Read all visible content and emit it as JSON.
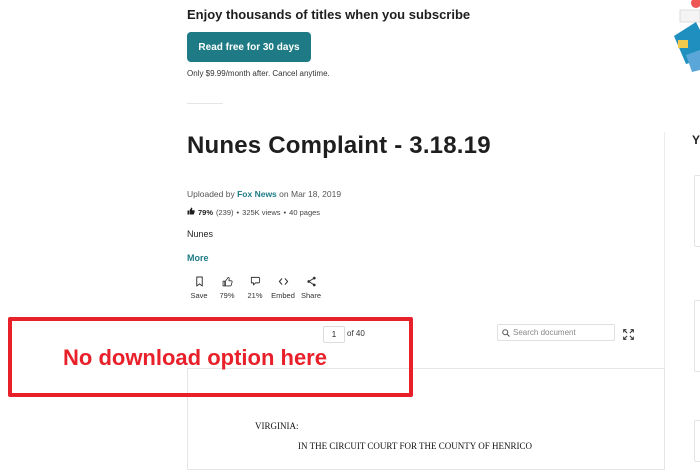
{
  "promo": {
    "title": "Enjoy thousands of titles when you subscribe",
    "cta_label": "Read free for 30 days",
    "note": "Only $9.99/month after. Cancel anytime."
  },
  "document": {
    "title": "Nunes Complaint - 3.18.19",
    "uploaded_prefix": "Uploaded by",
    "uploader": "Fox News",
    "uploaded_date": "on Mar 18, 2019",
    "rating_percent": "79%",
    "rating_count": "(239)",
    "views": "325K views",
    "pages": "40 pages",
    "description": "Nunes",
    "more_label": "More"
  },
  "actions": [
    {
      "label": "Save",
      "icon": "bookmark-icon"
    },
    {
      "label": "79%",
      "icon": "thumbs-up-icon"
    },
    {
      "label": "21%",
      "icon": "thumbs-down-icon"
    },
    {
      "label": "Embed",
      "icon": "embed-icon"
    },
    {
      "label": "Share",
      "icon": "share-icon"
    }
  ],
  "viewer": {
    "current_page": "1",
    "page_of": "of 40",
    "search_placeholder": "Search document",
    "page_lines": [
      "VIRGINIA:",
      "IN THE CIRCUIT COURT FOR THE COUNTY OF HENRICO"
    ]
  },
  "sidebar": {
    "title_fragment": "Y"
  },
  "annotation": {
    "text": "No download option here",
    "color": "#e8202a"
  },
  "colors": {
    "accent": "#1e7b85"
  }
}
